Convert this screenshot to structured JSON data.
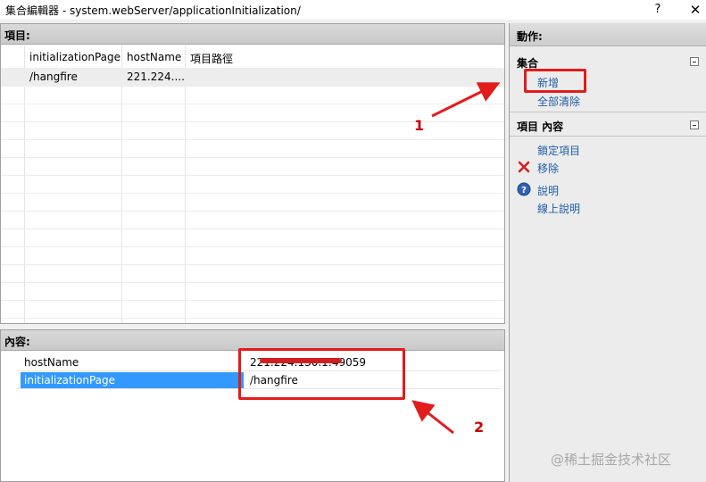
{
  "window": {
    "title": "集合編輯器 - system.webServer/applicationInitialization/",
    "help_label": "?",
    "close_label": "✕"
  },
  "items_panel": {
    "header": "項目:",
    "columns": [
      "initializationPage",
      "hostName",
      "項目路徑"
    ],
    "rows": [
      {
        "initializationPage": "/hangfire",
        "hostName": "221.224....",
        "path": ""
      }
    ]
  },
  "actions_panel": {
    "header": "動作:",
    "sections": [
      {
        "title": "集合",
        "items": [
          {
            "label": "新增",
            "icon": ""
          },
          {
            "label": "全部清除",
            "icon": ""
          }
        ]
      },
      {
        "title": "項目 內容",
        "items": [
          {
            "label": "鎖定項目",
            "icon": ""
          },
          {
            "label": "移除",
            "icon": "remove-x-icon"
          },
          {
            "label": "說明",
            "icon": "help-circle-icon"
          },
          {
            "label": "線上說明",
            "icon": ""
          }
        ]
      }
    ]
  },
  "properties_panel": {
    "header": "內容:",
    "rows": [
      {
        "name": "hostName",
        "value": "221.224.130.1:49059",
        "value_redacted": true
      },
      {
        "name": "initializationPage",
        "value": "/hangfire",
        "selected": true
      }
    ]
  },
  "annotations": {
    "label_1": "1",
    "label_2": "2",
    "color": "#e31b1b"
  },
  "watermark": "@稀土掘金技术社区"
}
